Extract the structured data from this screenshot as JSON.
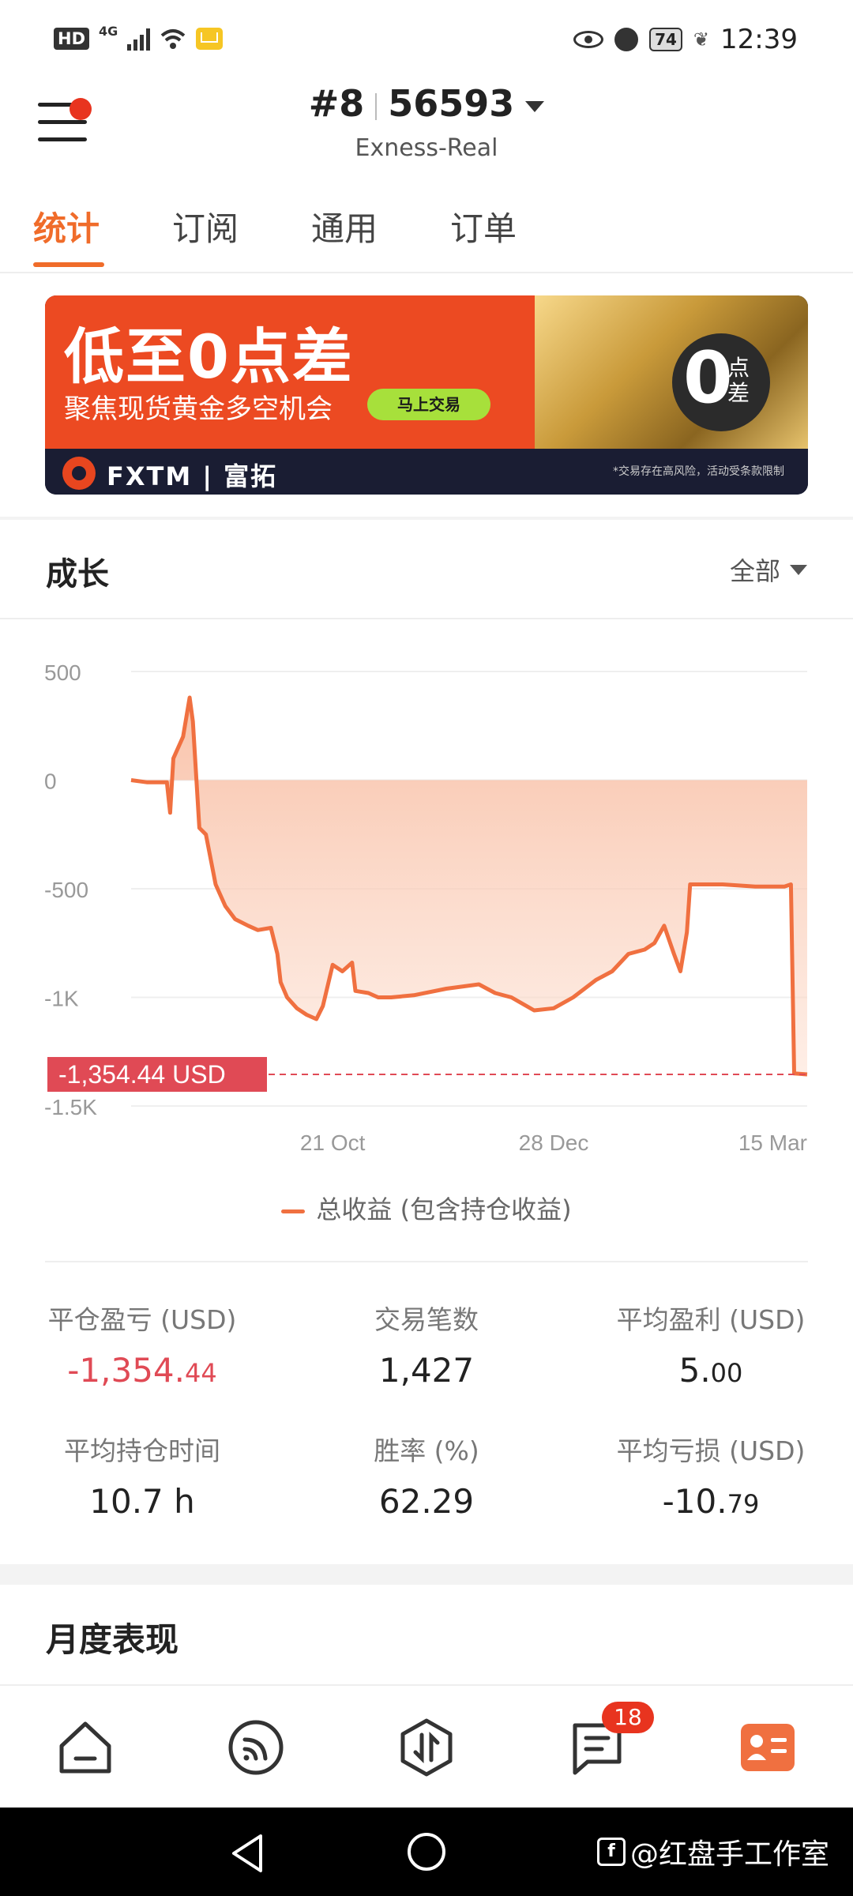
{
  "account": {
    "number_label": "#8",
    "account_id": "56593",
    "server": "Exness-Real"
  },
  "tabs": [
    {
      "label": "统计"
    },
    {
      "label": "订阅"
    },
    {
      "label": "通用"
    },
    {
      "label": "订单"
    }
  ],
  "banner": {
    "headline": "低至0点差",
    "subtext": "聚焦现货黄金多空机会",
    "cta": "马上交易",
    "badge_big": "0",
    "badge_small": "点差",
    "brand": "FXTM | 富拓",
    "disclaimer": "*交易存在高风险，活动受条款限制"
  },
  "growth": {
    "title": "成长",
    "filter": "全部"
  },
  "chart_data": {
    "type": "area",
    "series": [
      {
        "name": "总收益 (包含持仓收益)",
        "color": "#f07040",
        "x": [
          "2023-08-20",
          "2023-08-25",
          "2023-08-31",
          "2023-09-01",
          "2023-09-02",
          "2023-09-05",
          "2023-09-07",
          "2023-09-08",
          "2023-09-10",
          "2023-09-12",
          "2023-09-15",
          "2023-09-18",
          "2023-09-21",
          "2023-09-25",
          "2023-09-28",
          "2023-10-02",
          "2023-10-04",
          "2023-10-05",
          "2023-10-07",
          "2023-10-10",
          "2023-10-13",
          "2023-10-16",
          "2023-10-18",
          "2023-10-21",
          "2023-10-24",
          "2023-10-27",
          "2023-10-28",
          "2023-11-01",
          "2023-11-04",
          "2023-11-08",
          "2023-11-15",
          "2023-11-25",
          "2023-12-05",
          "2023-12-10",
          "2023-12-15",
          "2023-12-22",
          "2023-12-28",
          "2024-01-03",
          "2024-01-10",
          "2024-01-15",
          "2024-01-20",
          "2024-01-25",
          "2024-01-28",
          "2024-01-31",
          "2024-02-03",
          "2024-02-05",
          "2024-02-07",
          "2024-02-08",
          "2024-02-18",
          "2024-02-28",
          "2024-03-08",
          "2024-03-10",
          "2024-03-11",
          "2024-03-15"
        ],
        "values": [
          0,
          -10,
          -10,
          -150,
          100,
          200,
          380,
          270,
          -220,
          -250,
          -480,
          -580,
          -640,
          -670,
          -690,
          -680,
          -800,
          -930,
          -1000,
          -1050,
          -1080,
          -1100,
          -1040,
          -850,
          -880,
          -840,
          -970,
          -980,
          -1000,
          -1000,
          -990,
          -960,
          -940,
          -980,
          -1000,
          -1060,
          -1050,
          -1000,
          -920,
          -880,
          -800,
          -780,
          -750,
          -670,
          -800,
          -880,
          -700,
          -480,
          -480,
          -490,
          -490,
          -480,
          -1350,
          -1354.44
        ]
      }
    ],
    "y_ticks": [
      "500",
      "0",
      "-500",
      "-1K",
      "-1.5K"
    ],
    "x_ticks": [
      "21 Oct",
      "28 Dec",
      "15 Mar"
    ],
    "ylim": [
      -1500,
      500
    ],
    "current_value_label": "-1,354.44 USD",
    "grid": true,
    "legend": "bottom-center"
  },
  "legend_label": "总收益 (包含持仓收益)",
  "stats": [
    {
      "label": "平仓盈亏 (USD)",
      "int": "-1,354.",
      "dec": "44",
      "negative": true
    },
    {
      "label": "交易笔数",
      "int": "1,427",
      "dec": "",
      "negative": false
    },
    {
      "label": "平均盈利 (USD)",
      "int": "5.",
      "dec": "00",
      "negative": false
    },
    {
      "label": "平均持仓时间",
      "int": "10.7 h",
      "dec": "",
      "negative": false
    },
    {
      "label": "胜率 (%)",
      "int": "62.29",
      "dec": "",
      "negative": false
    },
    {
      "label": "平均亏损 (USD)",
      "int": "-10.",
      "dec": "79",
      "negative": false
    }
  ],
  "monthly": {
    "title": "月度表现"
  },
  "bottom_nav": {
    "messages_badge": "18",
    "items": [
      "home-icon",
      "signals-icon",
      "trade-icon",
      "messages-icon",
      "profile-icon"
    ],
    "active_color": "#f07040"
  },
  "status_bar": {
    "network": "HD",
    "lte": "4G",
    "battery": "74",
    "time": "12:39"
  },
  "watermark": "@红盘手工作室"
}
